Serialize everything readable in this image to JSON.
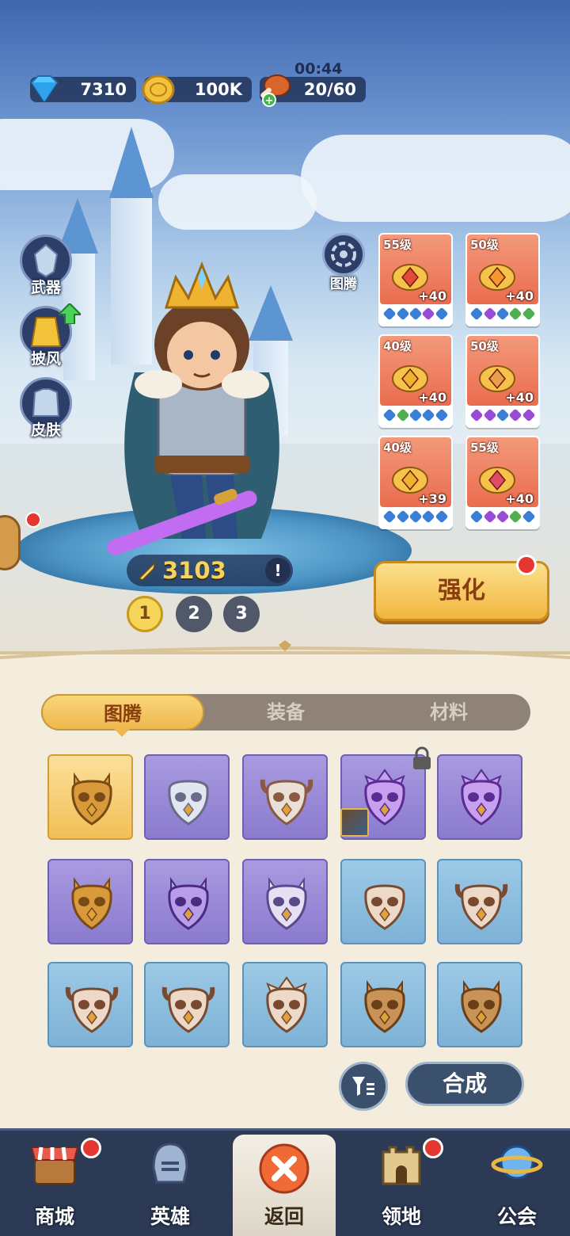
{
  "resources": {
    "gems": "7310",
    "gold": "100K",
    "stamina": "20/60",
    "stamina_timer": "00:44"
  },
  "side_buttons": [
    {
      "label": "武器",
      "icon": "weapon-icon"
    },
    {
      "label": "披风",
      "icon": "cloak-icon",
      "upgrade": true
    },
    {
      "label": "皮肤",
      "icon": "skin-icon"
    }
  ],
  "hero": {
    "power": "3103",
    "pages": [
      "1",
      "2",
      "3"
    ],
    "active_page": "1"
  },
  "totem_button": {
    "label": "图腾",
    "icon": "totem-icon"
  },
  "equipment": [
    {
      "level": "55级",
      "plus": "+40",
      "slot": "amulet",
      "hexes": [
        "#3a7fd6",
        "#3a7fd6",
        "#3a7fd6",
        "#9a4bd6",
        "#3a7fd6"
      ]
    },
    {
      "level": "50级",
      "plus": "+40",
      "slot": "ring",
      "hexes": [
        "#3a7fd6",
        "#9a4bd6",
        "#3a7fd6",
        "#4fae4f",
        "#4fae4f"
      ]
    },
    {
      "level": "40级",
      "plus": "+40",
      "slot": "crown",
      "hexes": [
        "#3a7fd6",
        "#4fae4f",
        "#3a7fd6",
        "#3a7fd6",
        "#3a7fd6"
      ]
    },
    {
      "level": "50级",
      "plus": "+40",
      "slot": "horn",
      "hexes": [
        "#9a4bd6",
        "#9a4bd6",
        "#3a7fd6",
        "#9a4bd6",
        "#9a4bd6"
      ]
    },
    {
      "level": "40级",
      "plus": "+39",
      "slot": "armor",
      "hexes": [
        "#3a7fd6",
        "#3a7fd6",
        "#3a7fd6",
        "#3a7fd6",
        "#3a7fd6"
      ]
    },
    {
      "level": "55级",
      "plus": "+40",
      "slot": "gauntlet",
      "hexes": [
        "#3a7fd6",
        "#9a4bd6",
        "#9a4bd6",
        "#4fae4f",
        "#3a7fd6"
      ]
    }
  ],
  "upgrade_button": "强化",
  "tabs": [
    {
      "label": "图腾",
      "active": true
    },
    {
      "label": "装备",
      "active": false
    },
    {
      "label": "材料",
      "active": false
    }
  ],
  "totems": [
    {
      "rarity": "gold",
      "mask": "owl"
    },
    {
      "rarity": "purple",
      "mask": "bear"
    },
    {
      "rarity": "purple",
      "mask": "bull"
    },
    {
      "rarity": "purple",
      "mask": "bird",
      "locked": true,
      "equipped": true
    },
    {
      "rarity": "purple",
      "mask": "bird"
    },
    {
      "rarity": "purple",
      "mask": "owl"
    },
    {
      "rarity": "purple",
      "mask": "wolf"
    },
    {
      "rarity": "purple",
      "mask": "cat"
    },
    {
      "rarity": "blue",
      "mask": "bear"
    },
    {
      "rarity": "blue",
      "mask": "bull"
    },
    {
      "rarity": "blue",
      "mask": "bull"
    },
    {
      "rarity": "blue",
      "mask": "bull"
    },
    {
      "rarity": "blue",
      "mask": "bird"
    },
    {
      "rarity": "blue",
      "mask": "owl"
    },
    {
      "rarity": "blue",
      "mask": "owl"
    }
  ],
  "compose_button": "合成",
  "filter_icon": "filter-icon",
  "nav": [
    {
      "label": "商城",
      "icon": "shop-icon",
      "badge": true
    },
    {
      "label": "英雄",
      "icon": "helmet-icon",
      "badge": false
    },
    {
      "label": "返回",
      "icon": "close-icon",
      "badge": false,
      "active": true
    },
    {
      "label": "领地",
      "icon": "castle-icon",
      "badge": true
    },
    {
      "label": "公会",
      "icon": "planet-icon",
      "badge": false
    }
  ]
}
